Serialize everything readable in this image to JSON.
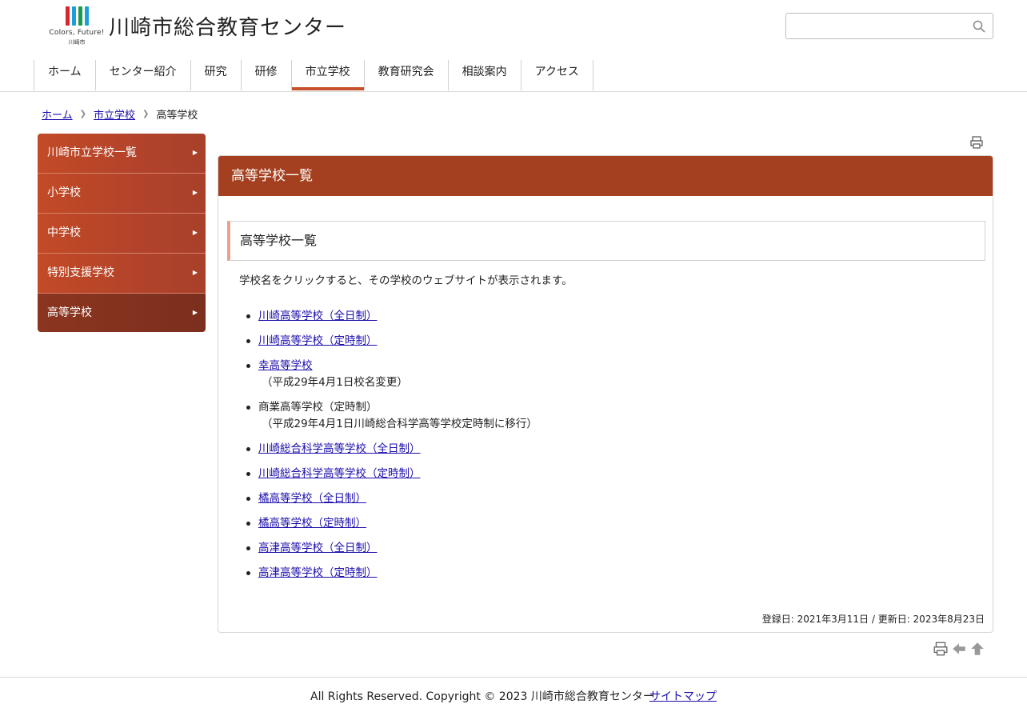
{
  "header": {
    "logo_text": "Colors, Future!",
    "logo_sub": "川崎市",
    "site_title": "川崎市総合教育センター",
    "search_placeholder": "",
    "logo_colors": [
      "#d7262e",
      "#1a9fd8",
      "#1a9b4b",
      "#1a9fd8"
    ]
  },
  "nav": {
    "items": [
      {
        "label": "ホーム"
      },
      {
        "label": "センター紹介"
      },
      {
        "label": "研究"
      },
      {
        "label": "研修"
      },
      {
        "label": "市立学校",
        "active": true
      },
      {
        "label": "教育研究会"
      },
      {
        "label": "相談案内"
      },
      {
        "label": "アクセス"
      }
    ]
  },
  "breadcrumb": {
    "home": "ホーム",
    "parent": "市立学校",
    "current": "高等学校"
  },
  "sidebar": {
    "items": [
      {
        "label": "川崎市立学校一覧"
      },
      {
        "label": "小学校"
      },
      {
        "label": "中学校"
      },
      {
        "label": "特別支援学校"
      },
      {
        "label": "高等学校",
        "active": true
      }
    ]
  },
  "main": {
    "title": "高等学校一覧",
    "subtitle": "高等学校一覧",
    "intro": "学校名をクリックすると、その学校のウェブサイトが表示されます。",
    "schools": [
      {
        "name": "川崎高等学校（全日制）",
        "link": true
      },
      {
        "name": "川崎高等学校（定時制）",
        "link": true
      },
      {
        "name": "幸高等学校",
        "link": true,
        "note": "（平成29年4月1日校名変更）"
      },
      {
        "name": "商業高等学校（定時制）",
        "link": false,
        "note": "（平成29年4月1日川崎総合科学高等学校定時制に移行）"
      },
      {
        "name": "川崎総合科学高等学校（全日制）",
        "link": true
      },
      {
        "name": "川崎総合科学高等学校（定時制）",
        "link": true
      },
      {
        "name": "橘高等学校（全日制）",
        "link": true
      },
      {
        "name": "橘高等学校（定時制）",
        "link": true
      },
      {
        "name": "高津高等学校（全日制）",
        "link": true
      },
      {
        "name": "高津高等学校（定時制）",
        "link": true
      }
    ],
    "dates": "登録日: 2021年3月11日 /  更新日: 2023年8月23日"
  },
  "footer": {
    "copyright": "All Rights Reserved. Copyright © 2023 川崎市総合教育センター",
    "sitemap": "サイトマップ"
  },
  "colors": {
    "accent": "#a4401f",
    "sidebar": "#c24a27",
    "sidebar_active": "#7b2f1d",
    "link": "#1a0dab"
  }
}
